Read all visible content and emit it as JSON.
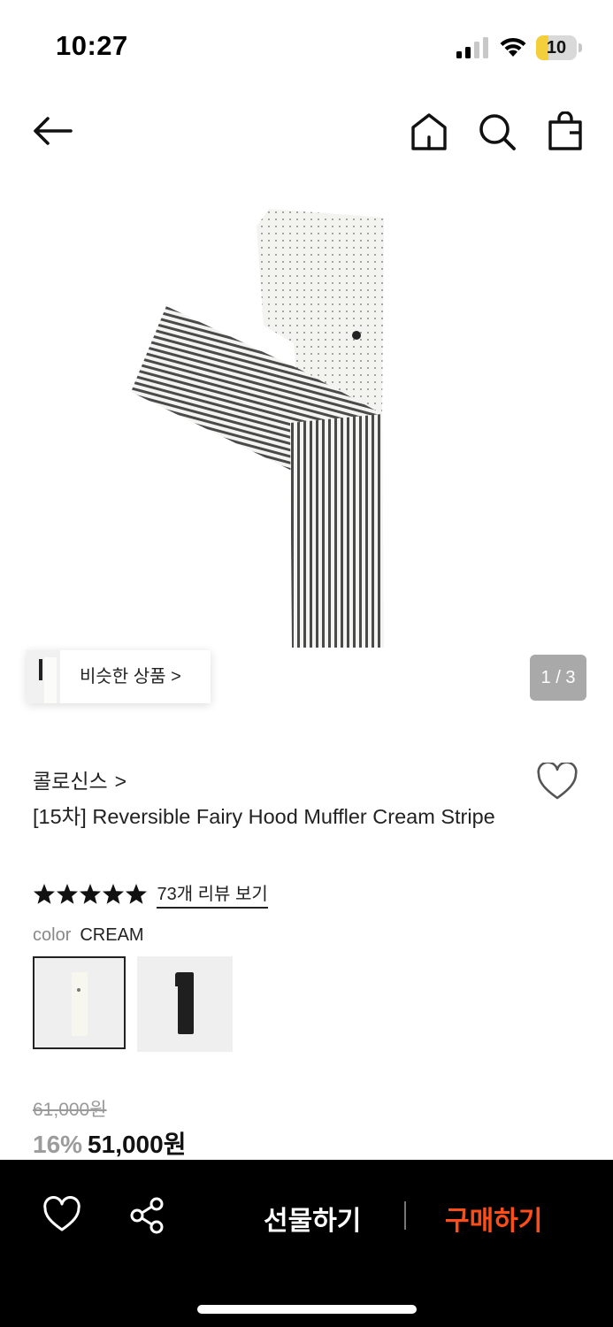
{
  "status_bar": {
    "time": "10:27",
    "battery": "10",
    "battery_color": "#f3cf3b"
  },
  "header": {
    "icons": [
      "arrow-left-icon",
      "home-icon",
      "search-icon",
      "shopping-bag-icon"
    ]
  },
  "gallery": {
    "similar_label": "비슷한 상품 >",
    "counter": "1 / 3"
  },
  "product": {
    "brand": "콜로신스",
    "brand_chevron": ">",
    "title": "[15차] Reversible Fairy Hood Muffler Cream Stripe",
    "rating_stars": 5,
    "review_link": "73개 리뷰 보기",
    "color_label": "color",
    "color_value": "CREAM",
    "original_price": "61,000원",
    "discount": "16%",
    "price": "51,000원"
  },
  "bottom_bar": {
    "gift_label": "선물하기",
    "buy_label": "구매하기",
    "buy_color": "#ff4d1a",
    "icons": [
      "heart-icon",
      "share-icon"
    ]
  }
}
